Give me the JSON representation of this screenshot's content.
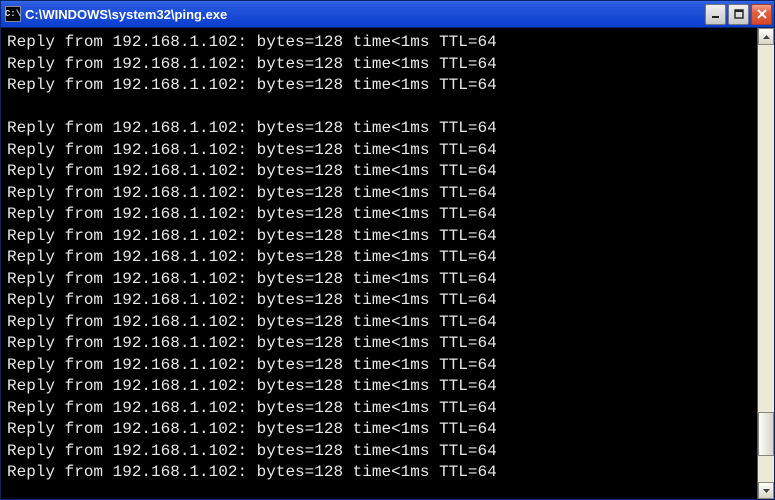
{
  "window": {
    "title": "C:\\WINDOWS\\system32\\ping.exe",
    "icon_label": "C:\\"
  },
  "terminal": {
    "lines": [
      "Reply from 192.168.1.102: bytes=128 time<1ms TTL=64",
      "Reply from 192.168.1.102: bytes=128 time<1ms TTL=64",
      "Reply from 192.168.1.102: bytes=128 time<1ms TTL=64",
      "",
      "Reply from 192.168.1.102: bytes=128 time<1ms TTL=64",
      "Reply from 192.168.1.102: bytes=128 time<1ms TTL=64",
      "Reply from 192.168.1.102: bytes=128 time<1ms TTL=64",
      "Reply from 192.168.1.102: bytes=128 time<1ms TTL=64",
      "Reply from 192.168.1.102: bytes=128 time<1ms TTL=64",
      "Reply from 192.168.1.102: bytes=128 time<1ms TTL=64",
      "Reply from 192.168.1.102: bytes=128 time<1ms TTL=64",
      "Reply from 192.168.1.102: bytes=128 time<1ms TTL=64",
      "Reply from 192.168.1.102: bytes=128 time<1ms TTL=64",
      "Reply from 192.168.1.102: bytes=128 time<1ms TTL=64",
      "Reply from 192.168.1.102: bytes=128 time<1ms TTL=64",
      "Reply from 192.168.1.102: bytes=128 time<1ms TTL=64",
      "Reply from 192.168.1.102: bytes=128 time<1ms TTL=64",
      "Reply from 192.168.1.102: bytes=128 time<1ms TTL=64",
      "Reply from 192.168.1.102: bytes=128 time<1ms TTL=64",
      "Reply from 192.168.1.102: bytes=128 time<1ms TTL=64",
      "Reply from 192.168.1.102: bytes=128 time<1ms TTL=64"
    ]
  },
  "scrollbar": {
    "thumb_top_pct": 84,
    "thumb_height_pct": 10
  }
}
